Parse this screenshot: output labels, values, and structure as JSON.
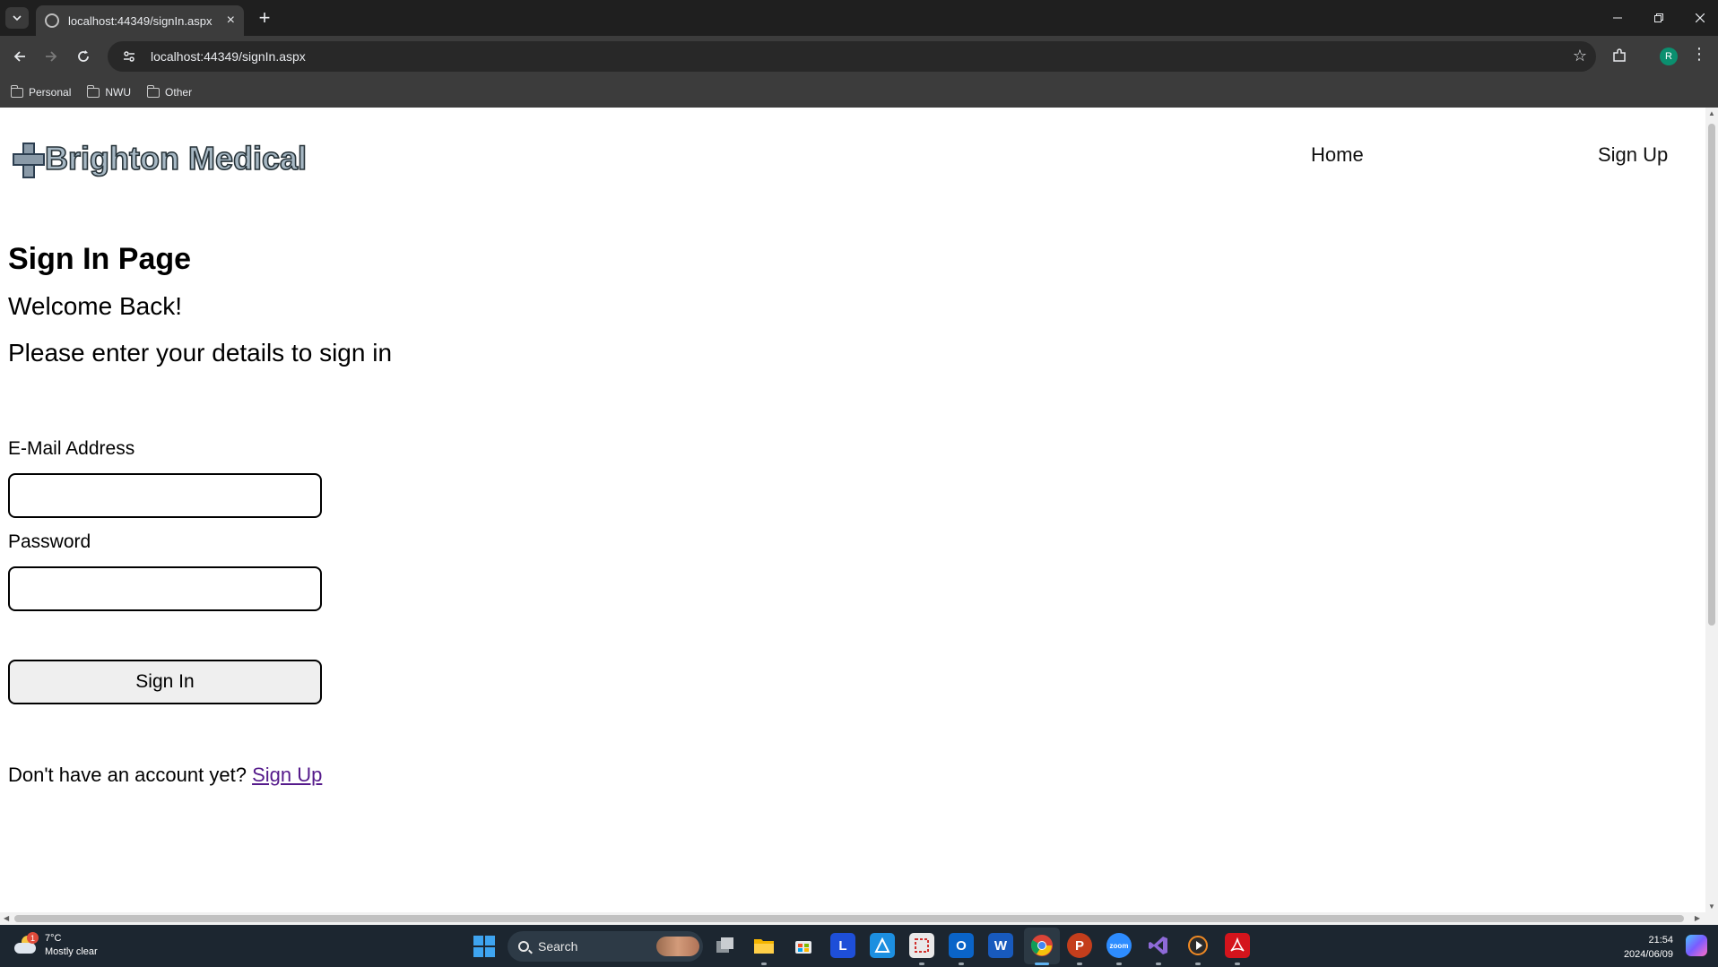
{
  "browser": {
    "tab_title": "localhost:44349/signIn.aspx",
    "url": "localhost:44349/signIn.aspx",
    "profile_initial": "R",
    "bookmarks": [
      "Personal",
      "NWU",
      "Other"
    ]
  },
  "site": {
    "logo_text": "Brighton Medical",
    "nav": {
      "home": "Home",
      "sign_up": "Sign Up"
    }
  },
  "signin": {
    "heading": "Sign In Page",
    "welcome": "Welcome Back!",
    "instructions": "Please enter your details to sign in",
    "email_label": "E-Mail Address",
    "email_value": "",
    "password_label": "Password",
    "password_value": "",
    "button_label": "Sign In",
    "no_account_text": "Don't have an account yet?",
    "signup_link": "Sign Up"
  },
  "taskbar": {
    "weather_badge": "1",
    "temperature": "7°C",
    "condition": "Mostly clear",
    "search_label": "Search",
    "time": "21:54",
    "date": "2024/06/09"
  },
  "colors": {
    "chrome_dark": "#1f1f1f",
    "chrome_toolbar": "#3c3c3c",
    "visited_link": "#551a8b",
    "taskbar": "#1c2630"
  }
}
